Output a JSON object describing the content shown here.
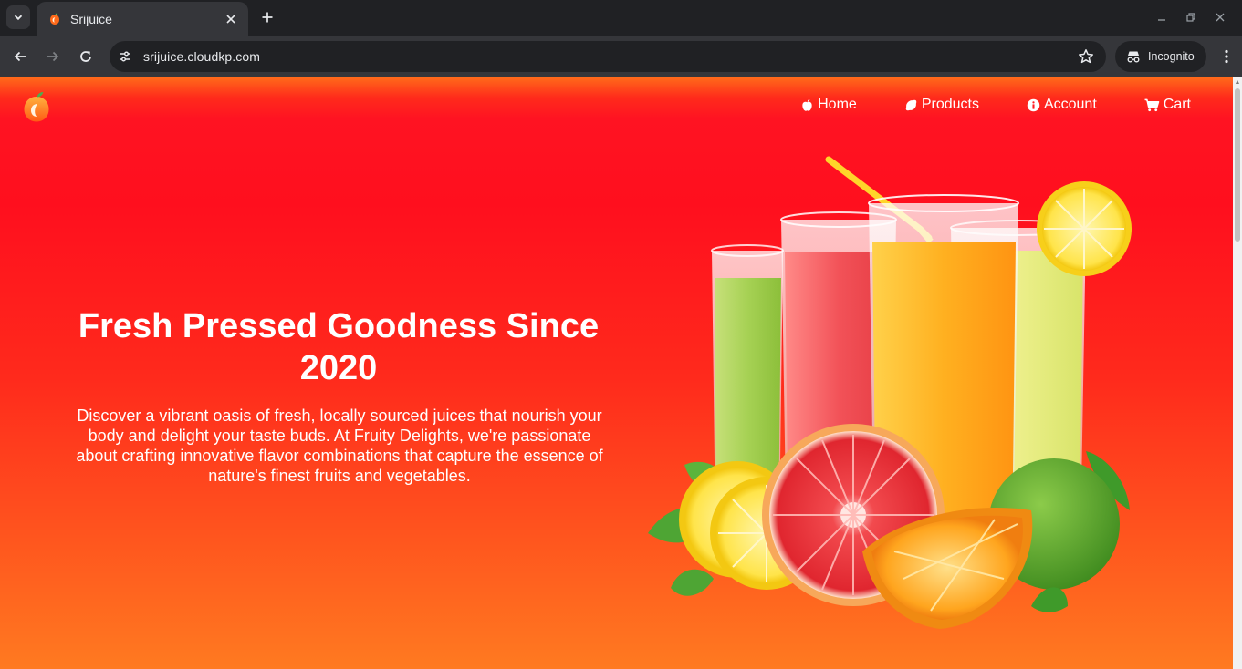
{
  "browser": {
    "tab": {
      "title": "Srijuice",
      "favicon": "juice-logo-icon"
    },
    "address_bar": {
      "url": "srijuice.cloudkp.com"
    },
    "profile": {
      "label": "Incognito"
    }
  },
  "site": {
    "brand_colors": {
      "primary": "#ff1a1f",
      "accent": "#ff7a20"
    },
    "nav": [
      {
        "label": "Home",
        "icon": "apple-icon"
      },
      {
        "label": "Products",
        "icon": "lemon-icon"
      },
      {
        "label": "Account",
        "icon": "info-icon"
      },
      {
        "label": "Cart",
        "icon": "cart-icon"
      }
    ],
    "hero": {
      "title": "Fresh Pressed Goodness Since 2020",
      "description": "Discover a vibrant oasis of fresh, locally sourced juices that nourish your body and delight your taste buds. At Fruity Delights, we're passionate about crafting innovative flavor combinations that capture the essence of nature's finest fruits and vegetables."
    }
  }
}
